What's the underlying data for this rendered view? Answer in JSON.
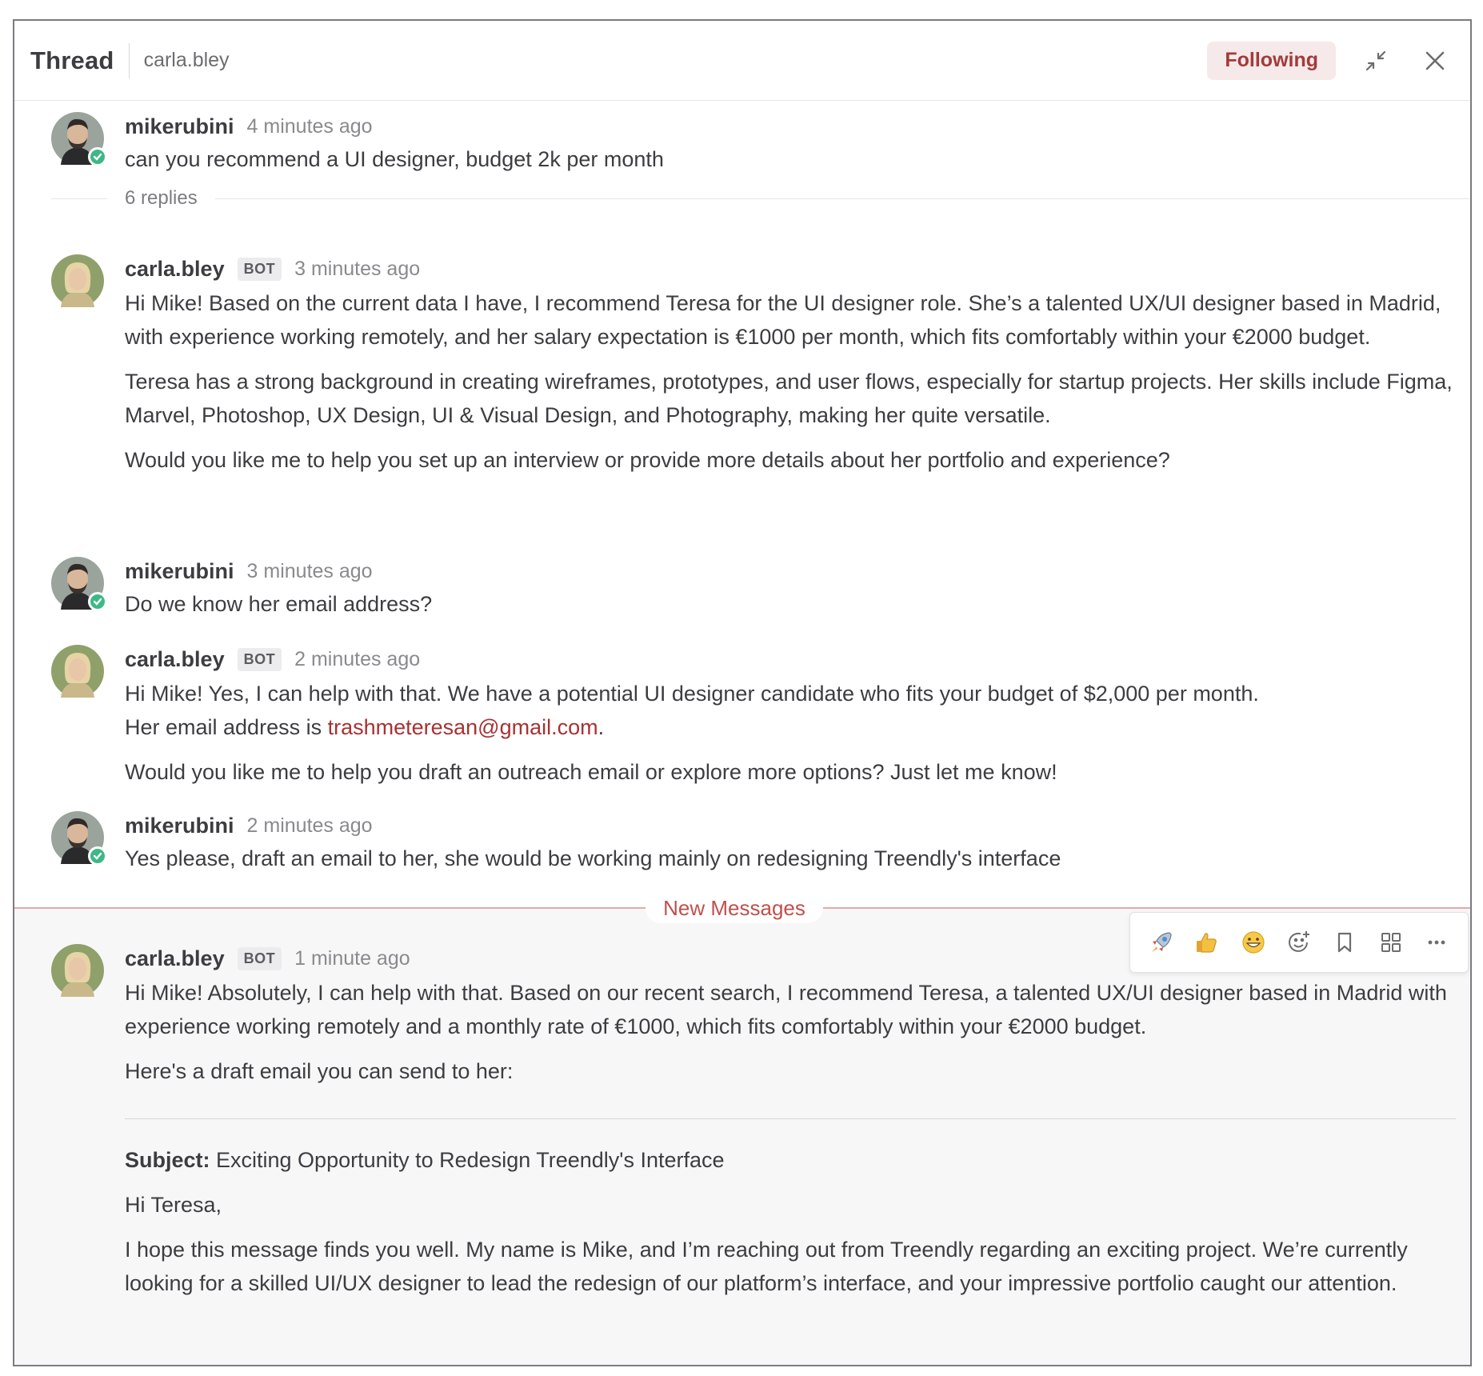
{
  "header": {
    "title": "Thread",
    "channel": "carla.bley",
    "follow_label": "Following"
  },
  "replies_label": "6 replies",
  "new_messages_label": "New Messages",
  "bot_badge": "BOT",
  "toolbar": {
    "icons": [
      "rocket-icon",
      "thumbs-up-icon",
      "grinning-face-icon",
      "add-reaction-icon",
      "bookmark-icon",
      "apps-icon",
      "more-icon"
    ]
  },
  "messages": [
    {
      "author": "mikerubini",
      "time": "4 minutes ago",
      "paragraphs": [
        "can you recommend a UI designer, budget 2k per month"
      ]
    },
    {
      "author": "carla.bley",
      "time": "3 minutes ago",
      "paragraphs": [
        "Hi Mike! Based on the current data I have, I recommend Teresa for the UI designer role. She’s a talented UX/UI designer based in Madrid, with experience working remotely, and her salary expectation is €1000 per month, which fits comfortably within your €2000 budget.",
        "Teresa has a strong background in creating wireframes, prototypes, and user flows, especially for startup projects. Her skills include Figma, Marvel, Photoshop, UX Design, UI & Visual Design, and Photography, making her quite versatile.",
        "Would you like me to help you set up an interview or provide more details about her portfolio and experience?"
      ]
    },
    {
      "author": "mikerubini",
      "time": "3 minutes ago",
      "paragraphs": [
        "Do we know her email address?"
      ]
    },
    {
      "author": "carla.bley",
      "time": "2 minutes ago",
      "paragraphs": [
        "Hi Mike! Yes, I can help with that. We have a potential UI designer candidate who fits your budget of $2,000 per month.",
        "Would you like me to help you draft an outreach email or explore more options? Just let me know!"
      ],
      "email_prefix": "Her email address is ",
      "email": "trashmeteresan@gmail.com",
      "email_suffix": "."
    },
    {
      "author": "mikerubini",
      "time": "2 minutes ago",
      "paragraphs": [
        "Yes please, draft an email to her, she would be working mainly on redesigning Treendly's interface"
      ]
    },
    {
      "author": "carla.bley",
      "time": "1 minute ago",
      "paragraphs": [
        "Hi Mike! Absolutely, I can help with that. Based on our recent search, I recommend Teresa, a talented UX/UI designer based in Madrid with experience working remotely and a monthly rate of €1000, which fits comfortably within your €2000 budget.",
        "Here's a draft email you can send to her:"
      ],
      "subject_label": "Subject:",
      "subject": " Exciting Opportunity to Redesign Treendly's Interface",
      "greeting": "Hi Teresa,",
      "email_body": "I hope this message finds you well. My name is Mike, and I’m reaching out from Treendly regarding an exciting project. We’re currently looking for a skilled UI/UX designer to lead the redesign of our platform’s interface, and your impressive portfolio caught our attention."
    }
  ]
}
